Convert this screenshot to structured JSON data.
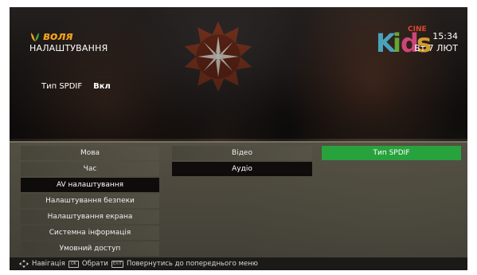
{
  "header": {
    "brand": "воля",
    "title": "НАЛАШТУВАННЯ",
    "time": "15:34",
    "date": "Вт 7 ЛЮТ",
    "channel_logo_text": "Kids",
    "channel_logo_sub": "CINE"
  },
  "info": {
    "label": "Тип SPDIF",
    "value": "Вкл"
  },
  "menu": {
    "main": [
      "Мова",
      "Час",
      "AV налаштування",
      "Налаштування безпеки",
      "Налаштування екрана",
      "Системна інформація",
      "Умовний доступ"
    ],
    "sub": [
      "Відео",
      "Аудіо"
    ],
    "options": [
      "Тип SPDIF"
    ]
  },
  "footer": {
    "nav": "Навігація",
    "select": "Обрати",
    "back": "Повернутись до попереднього меню"
  },
  "colors": {
    "accent_green": "#28a23c",
    "brand_orange": "#f6a21b",
    "selection_dark": "#0e0c0b"
  }
}
